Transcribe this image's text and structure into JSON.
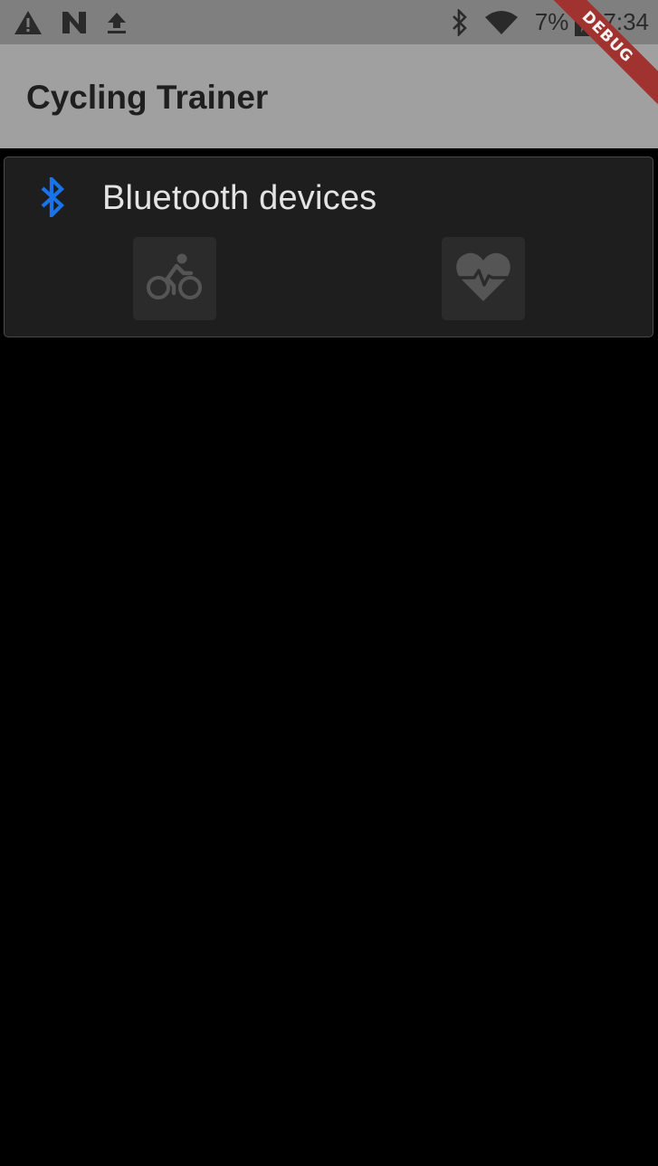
{
  "status_bar": {
    "left_icons": [
      "warning-icon",
      "n-icon",
      "upload-icon"
    ],
    "right_icons": [
      "bluetooth-icon",
      "wifi-icon",
      "battery-charging-icon"
    ],
    "battery_percent": "7%",
    "time": "7:34"
  },
  "debug_banner": {
    "label": "DEBUG"
  },
  "app_bar": {
    "title": "Cycling Trainer"
  },
  "card": {
    "icon": "bluetooth-icon",
    "icon_color": "#1a73e8",
    "title": "Bluetooth devices",
    "devices": [
      {
        "icon": "bicycle-icon",
        "name": "bike-device"
      },
      {
        "icon": "heart-rate-icon",
        "name": "heart-rate-device"
      }
    ]
  },
  "colors": {
    "background": "#000000",
    "status_bar": "#7f7f7f",
    "app_bar": "#a0a0a0",
    "card": "#1e1e1e",
    "device_button": "#2b2b2b",
    "device_icon": "#555555",
    "debug_banner": "#a0322f"
  }
}
